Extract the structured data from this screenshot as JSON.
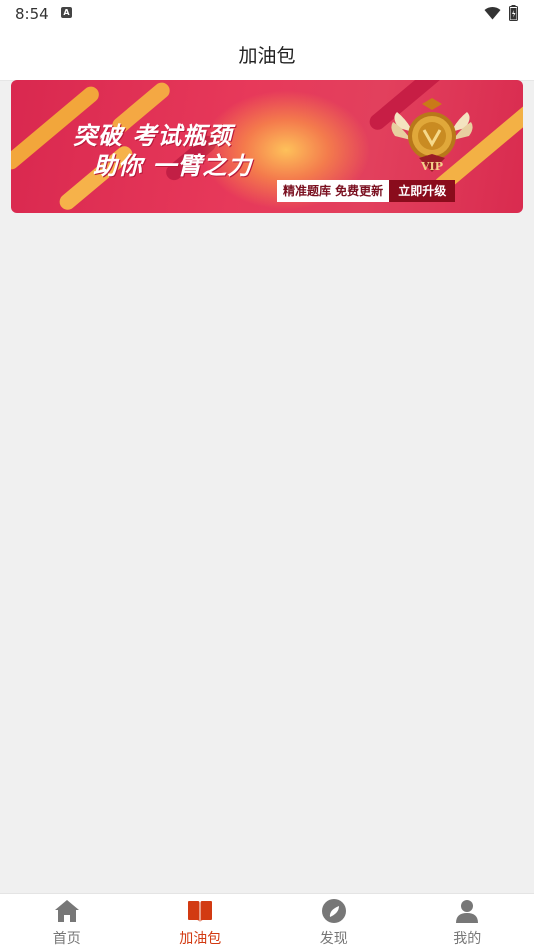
{
  "status_bar": {
    "time": "8:54",
    "notification_letter": "A"
  },
  "header": {
    "title": "加油包"
  },
  "banner": {
    "headline_line1": "突破 考试瓶颈",
    "headline_line2": "助你 一臂之力",
    "tagline": "精准题库 免费更新",
    "cta_label": "立即升级",
    "badge_text": "VIP"
  },
  "bottom_nav": {
    "items": [
      {
        "label": "首页",
        "icon": "home-icon",
        "active": false
      },
      {
        "label": "加油包",
        "icon": "book-icon",
        "active": true
      },
      {
        "label": "发现",
        "icon": "compass-icon",
        "active": false
      },
      {
        "label": "我的",
        "icon": "user-icon",
        "active": false
      }
    ]
  },
  "colors": {
    "active": "#d23a12",
    "inactive": "#777777",
    "banner": "#e2405d"
  }
}
